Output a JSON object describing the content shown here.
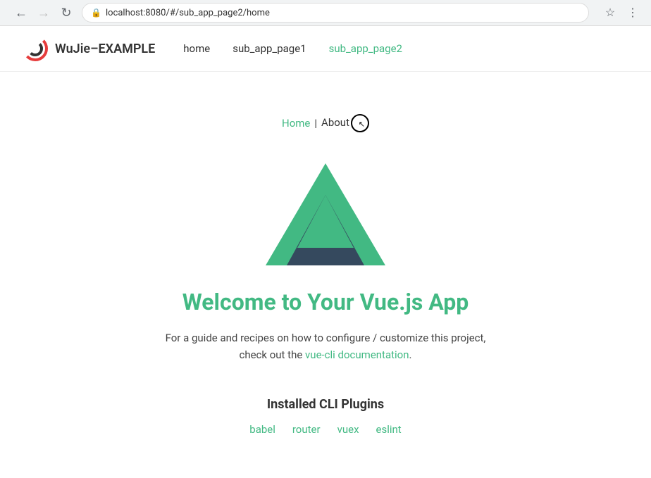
{
  "browser": {
    "url": "localhost:8080/#/sub_app_page2/home",
    "back_disabled": false,
    "forward_disabled": true
  },
  "app": {
    "logo_alt": "WuJie logo",
    "title": "WuJie–EXAMPLE",
    "nav": [
      {
        "label": "home",
        "active": false,
        "id": "home"
      },
      {
        "label": "sub_app_page1",
        "active": false,
        "id": "sub_app_page1"
      },
      {
        "label": "sub_app_page2",
        "active": true,
        "id": "sub_app_page2"
      }
    ]
  },
  "main": {
    "inner_nav": {
      "home_label": "Home",
      "separator": "|",
      "about_label": "About"
    },
    "welcome_title": "Welcome to Your Vue.js App",
    "welcome_desc_part1": "For a guide and recipes on how to configure / customize this project,",
    "welcome_desc_part2": "check out the",
    "welcome_desc_link": "vue-cli documentation",
    "welcome_desc_end": ".",
    "plugins_title": "Installed CLI Plugins",
    "plugins": [
      {
        "label": "babel",
        "url": "#"
      },
      {
        "label": "router",
        "url": "#"
      },
      {
        "label": "vuex",
        "url": "#"
      },
      {
        "label": "eslint",
        "url": "#"
      }
    ]
  }
}
